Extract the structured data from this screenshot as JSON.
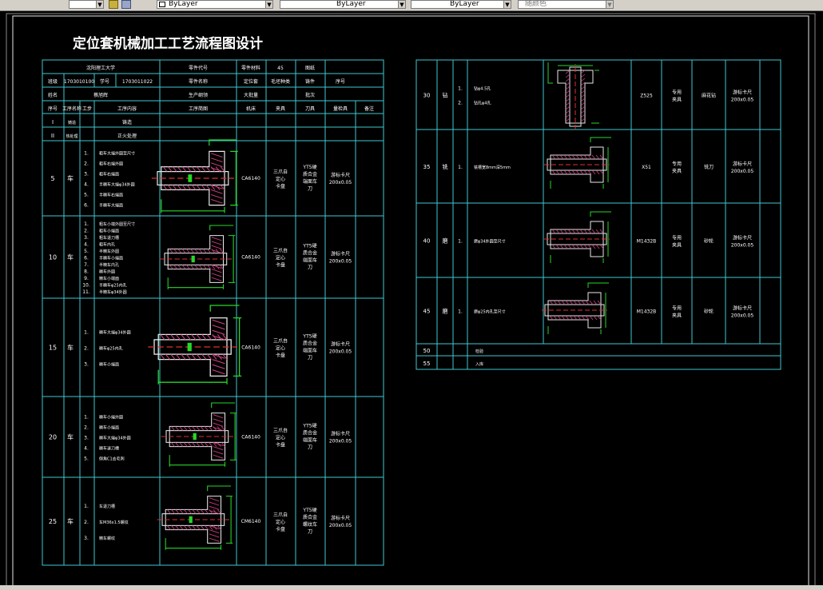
{
  "toolbar": {
    "color": "ByLayer",
    "linetype": "ByLayer",
    "lineweight": "ByLayer",
    "plotstyle": "随颜色"
  },
  "title": "定位套机械加工工艺流程图设计",
  "header": {
    "r1": [
      "沈阳理工大学",
      "零件代号",
      "零件材料",
      "45",
      "图纸"
    ],
    "r2": [
      "班级",
      "1703010100",
      "学号",
      "1703011022",
      "零件名称",
      "定位套",
      "毛坯种类",
      "铸件",
      "序号"
    ],
    "r3": [
      "姓名",
      "蔡旭辉",
      "生产纲领",
      "大批量",
      "批次"
    ],
    "cols": [
      "序号",
      "工序名称",
      "工步",
      "工序内容",
      "工序简图",
      "机床",
      "夹具",
      "刀具",
      "量检具",
      "备注"
    ]
  },
  "left_ops": [
    {
      "no": "I",
      "name": "铸造",
      "content": "铸造"
    },
    {
      "no": "II",
      "name": "热处理",
      "content": "正火处理"
    },
    {
      "no": "5",
      "name": "车",
      "steps": [
        "1.",
        "2.",
        "3.",
        "4.",
        "5.",
        "6."
      ],
      "lines": [
        "粗车大端外圆至尺寸",
        "粗车右端外圆",
        "粗车右端面",
        "半精车大端φ34外圆",
        "半精车右端面",
        "半精车大端面"
      ],
      "machine": "CA6140",
      "fixture": [
        "三爪自",
        "定心",
        "卡盘"
      ],
      "tool": [
        "YT5硬",
        "质合金",
        "端面车",
        "刀"
      ],
      "gauge": [
        "游标卡尺",
        "200x0.05"
      ]
    },
    {
      "no": "10",
      "name": "车",
      "steps": [
        "1.",
        "2.",
        "3.",
        "4.",
        "5.",
        "6.",
        "7.",
        "8.",
        "9.",
        "10.",
        "11."
      ],
      "lines": [
        "粗车小端外圆至尺寸",
        "粗车小端面",
        "粗车退刀槽",
        "粗车内孔",
        "半精车外圆",
        "半精车小端面",
        "半精车内孔",
        "精车外圆",
        "精车小端面",
        "半精车φ25内孔",
        "半精车φ34外圆"
      ],
      "machine": "CA6140",
      "fixture": [
        "三爪自",
        "定心",
        "卡盘"
      ],
      "tool": [
        "YT5硬",
        "质合金",
        "端面车",
        "刀"
      ],
      "gauge": [
        "游标卡尺",
        "200x0.05"
      ]
    },
    {
      "no": "15",
      "name": "车",
      "steps": [
        "1.",
        "2.",
        "3."
      ],
      "lines": [
        "精车大端φ34外圆",
        "精车φ25内孔",
        "精车小端面"
      ],
      "machine": "CA6140",
      "fixture": [
        "三爪自",
        "定心",
        "卡盘"
      ],
      "tool": [
        "YT5硬",
        "质合金",
        "端面车",
        "刀"
      ],
      "gauge": [
        "游标卡尺",
        "200x0.05"
      ]
    },
    {
      "no": "20",
      "name": "车",
      "steps": [
        "1.",
        "2.",
        "3.",
        "4.",
        "5."
      ],
      "lines": [
        "精车小端外圆",
        "精车小端面",
        "精车大端φ34外圆",
        "精车退刀槽",
        "倒角C1去毛刺"
      ],
      "machine": "CA6140",
      "fixture": [
        "三爪自",
        "定心",
        "卡盘"
      ],
      "tool": [
        "YT5硬",
        "质合金",
        "端面车",
        "刀"
      ],
      "gauge": [
        "游标卡尺",
        "200x0.05"
      ]
    },
    {
      "no": "25",
      "name": "车",
      "steps": [
        "1.",
        "2.",
        "3."
      ],
      "lines": [
        "车退刀槽",
        "车M36x1.5螺纹",
        "精车螺纹"
      ],
      "machine": "CM6140",
      "fixture": [
        "三爪自",
        "定心",
        "卡盘"
      ],
      "tool": [
        "YT5硬",
        "质合金",
        "螺纹车",
        "刀"
      ],
      "gauge": [
        "游标卡尺",
        "200x0.05"
      ]
    }
  ],
  "right_ops": [
    {
      "no": "30",
      "name": "钻",
      "steps": [
        "1.",
        "2."
      ],
      "lines": [
        "钻φ4.5孔",
        "钻孔φ4孔"
      ],
      "machine": "Z525",
      "fixture": [
        "专用",
        "夹具"
      ],
      "tool": "麻花钻",
      "gauge": [
        "游标卡尺",
        "200x0.05"
      ]
    },
    {
      "no": "35",
      "name": "铣",
      "steps": [
        "1."
      ],
      "lines": [
        "铣槽宽8mm深5mm"
      ],
      "machine": "X51",
      "fixture": [
        "专用",
        "夹具"
      ],
      "tool": "铣刀",
      "gauge": [
        "游标卡尺",
        "200x0.05"
      ]
    },
    {
      "no": "40",
      "name": "磨",
      "steps": [
        "1."
      ],
      "lines": [
        "磨φ34外圆至尺寸"
      ],
      "machine": "M1432B",
      "fixture": [
        "专用",
        "夹具"
      ],
      "tool": "砂轮",
      "gauge": [
        "游标卡尺",
        "200x0.05"
      ]
    },
    {
      "no": "45",
      "name": "磨",
      "steps": [
        "1."
      ],
      "lines": [
        "磨φ25内孔至尺寸"
      ],
      "machine": "M1432B",
      "fixture": [
        "专用",
        "夹具"
      ],
      "tool": "砂轮",
      "gauge": [
        "游标卡尺",
        "200x0.05"
      ]
    },
    {
      "no": "50",
      "content": "检验"
    },
    {
      "no": "55",
      "content": "入库"
    }
  ]
}
